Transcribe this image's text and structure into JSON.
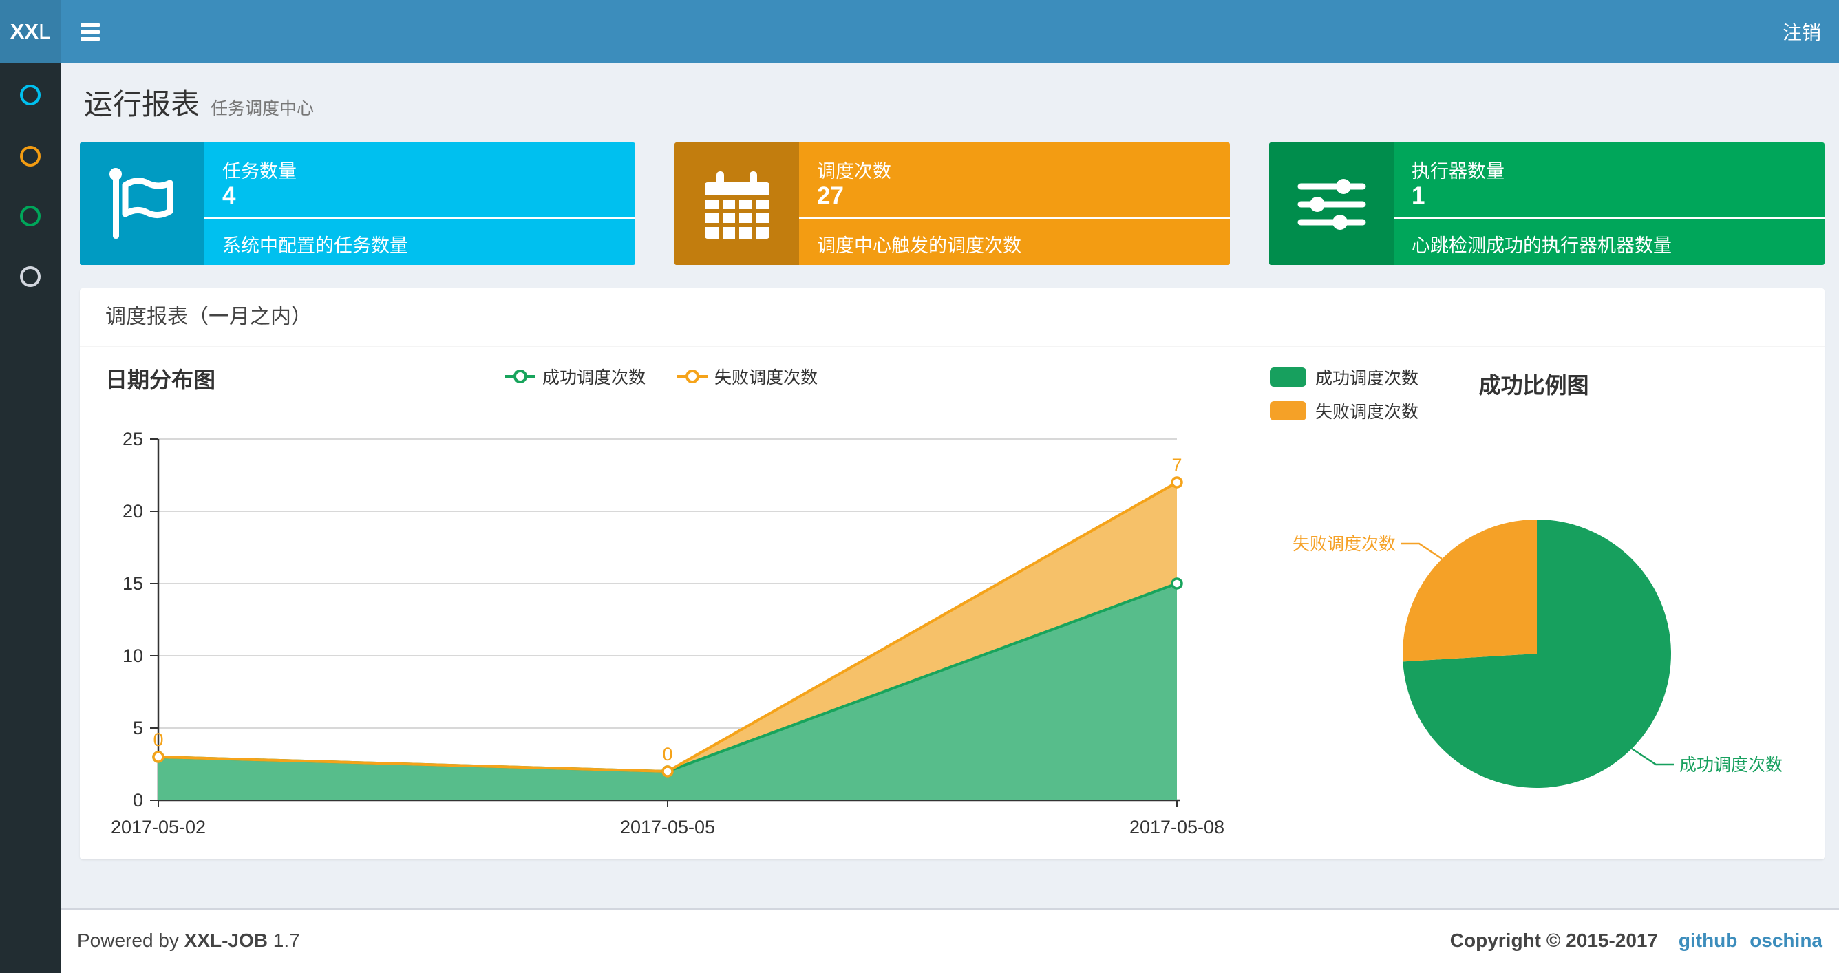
{
  "navbar": {
    "logo_bold": "XX",
    "logo_light": "L",
    "logout_label": "注销",
    "bg_color": "#3c8dbc",
    "logo_bg_color": "#367fa9"
  },
  "sidebar": {
    "bg_color": "#222d32",
    "items": [
      {
        "icon": "circle-outline-icon",
        "color": "#00c0ef"
      },
      {
        "icon": "circle-outline-icon",
        "color": "#f39c12"
      },
      {
        "icon": "circle-outline-icon",
        "color": "#00a65a"
      },
      {
        "icon": "circle-outline-icon",
        "color": "#d2d6de"
      }
    ]
  },
  "page_header": {
    "title": "运行报表",
    "subtitle": "任务调度中心"
  },
  "stat_cards": [
    {
      "title": "任务数量",
      "value": "4",
      "desc": "系统中配置的任务数量",
      "bg": "#00c0ef",
      "icon_bg": "#009bc2",
      "icon": "flag-icon"
    },
    {
      "title": "调度次数",
      "value": "27",
      "desc": "调度中心触发的调度次数",
      "bg": "#f39c12",
      "icon_bg": "#c27d0e",
      "icon": "calendar-icon"
    },
    {
      "title": "执行器数量",
      "value": "1",
      "desc": "心跳检测成功的执行器机器数量",
      "bg": "#00a65a",
      "icon_bg": "#008d4c",
      "icon": "sliders-icon"
    }
  ],
  "panel": {
    "title": "调度报表（一月之内）"
  },
  "chart_data": [
    {
      "type": "area",
      "title": "日期分布图",
      "categories": [
        "2017-05-02",
        "2017-05-05",
        "2017-05-08"
      ],
      "stacked": true,
      "series": [
        {
          "name": "成功调度次数",
          "values": [
            3,
            2,
            15
          ],
          "color": "#18a45c",
          "fill": "#57bd8b"
        },
        {
          "name": "失败调度次数",
          "values": [
            0,
            0,
            7
          ],
          "color": "#f5a31a",
          "fill": "#f6c169",
          "point_labels": [
            "0",
            "0",
            "7"
          ]
        }
      ],
      "xlabel": "",
      "ylabel": "",
      "ylim": [
        0,
        25
      ],
      "ytick": 5,
      "grid": true,
      "legend_position": "top-center"
    },
    {
      "type": "pie",
      "title": "成功比例图",
      "slices": [
        {
          "label": "成功调度次数",
          "value": 20,
          "color": "#17a05e"
        },
        {
          "label": "失败调度次数",
          "value": 7,
          "color": "#f5a127"
        }
      ],
      "legend_position": "top-left"
    }
  ],
  "footer": {
    "powered_prefix": "Powered by ",
    "product": "XXL-JOB",
    "version": " 1.7",
    "copyright": "Copyright © 2015-2017",
    "links": [
      {
        "label": "github"
      },
      {
        "label": "oschina"
      }
    ],
    "link_color": "#3c8dbc"
  }
}
